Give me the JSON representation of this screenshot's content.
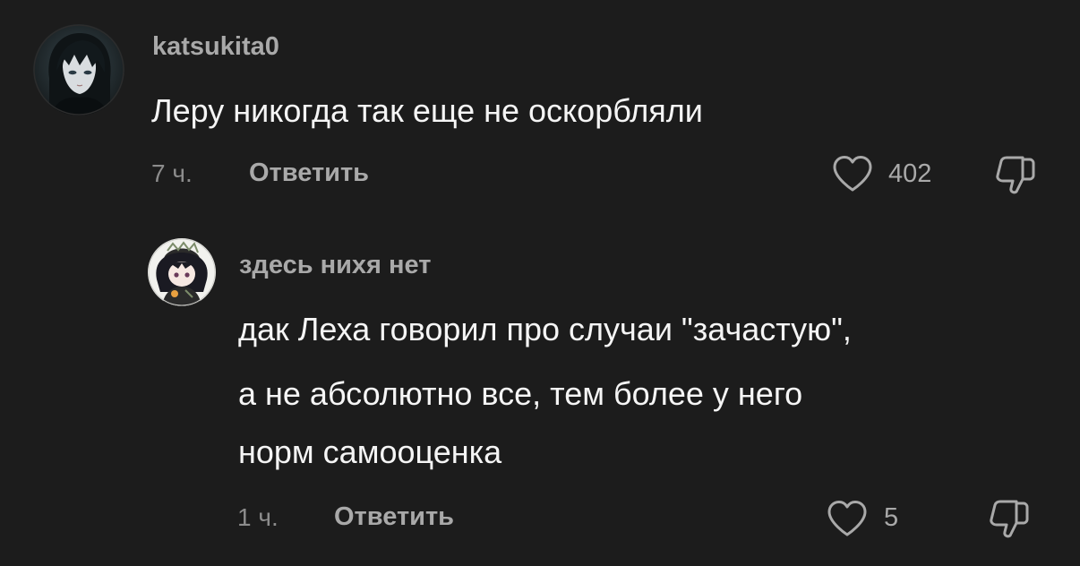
{
  "comments": [
    {
      "username": "katsukita0",
      "text_lines": [
        "Леру никогда так еще не оскорбляли"
      ],
      "time": "7 ч.",
      "reply_label": "Ответить",
      "likes": "402",
      "avatar_icon": "user-avatar-dark-hair",
      "like_icon": "heart-outline-icon",
      "dislike_icon": "thumbs-down-outline-icon"
    },
    {
      "username": "здесь нихя нет",
      "text_lines": [
        "дак Леха говорил про случаи \"зачастую\",",
        "а не абсолютно все, тем более у него",
        "норм самооценка"
      ],
      "time": "1 ч.",
      "reply_label": "Ответить",
      "likes": "5",
      "avatar_icon": "user-avatar-chibi",
      "like_icon": "heart-outline-icon",
      "dislike_icon": "thumbs-down-outline-icon"
    }
  ],
  "colors": {
    "background": "#1c1c1c",
    "text_primary": "#f5f5f5",
    "text_secondary": "#a9a9a9",
    "text_muted": "#8c8c8c"
  }
}
